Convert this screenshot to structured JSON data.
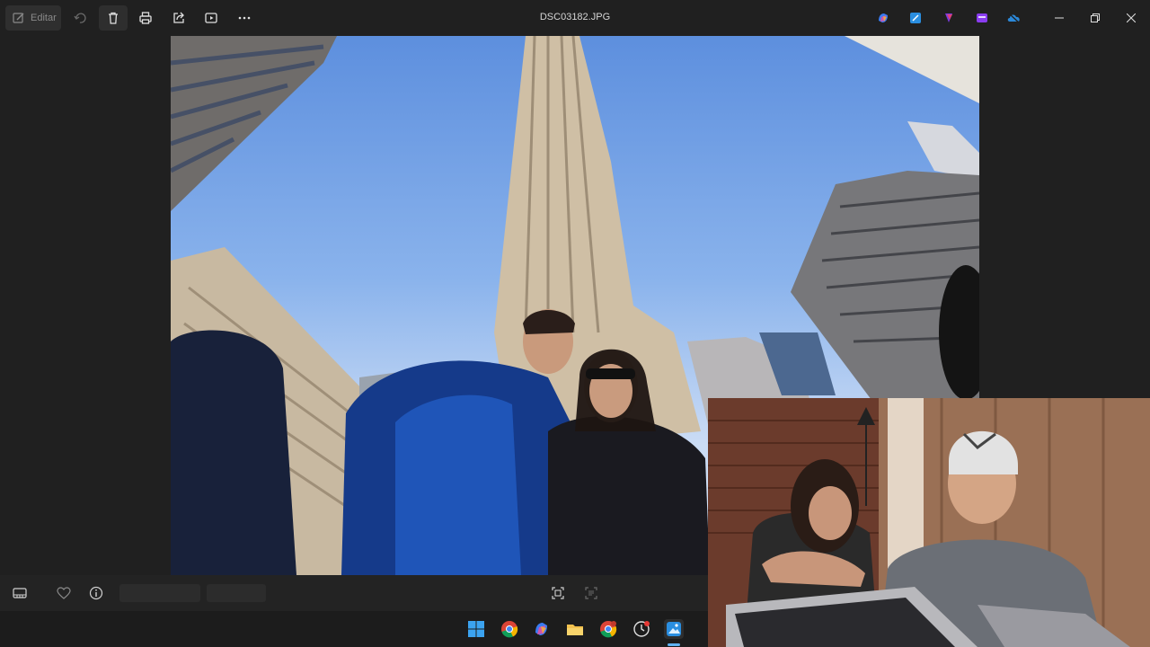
{
  "window": {
    "title": "DSC03182.JPG"
  },
  "toolbar": {
    "edit_label": "Editar",
    "icons": [
      "edit-icon",
      "rotate-icon",
      "delete-icon",
      "print-icon",
      "share-icon",
      "slideshow-icon",
      "more-icon"
    ]
  },
  "app_icons": [
    "copilot-icon",
    "photos-edit-icon",
    "clipchamp-icon",
    "designer-icon",
    "onedrive-icon"
  ],
  "window_controls": [
    "minimize-icon",
    "restore-icon",
    "close-icon"
  ],
  "bottom_bar": {
    "icons": [
      "filmstrip-icon",
      "favorite-icon",
      "info-icon",
      "fit-view-icon",
      "actual-size-icon"
    ]
  },
  "taskbar": {
    "icons": [
      "windows-start-icon",
      "chrome-icon",
      "copilot-icon",
      "file-explorer-icon",
      "chrome-profile-icon",
      "clock-app-icon",
      "photos-app-icon"
    ]
  },
  "colors": {
    "background": "#202020",
    "taskbar": "#1c1c1c",
    "accent": "#5fb2f2"
  }
}
